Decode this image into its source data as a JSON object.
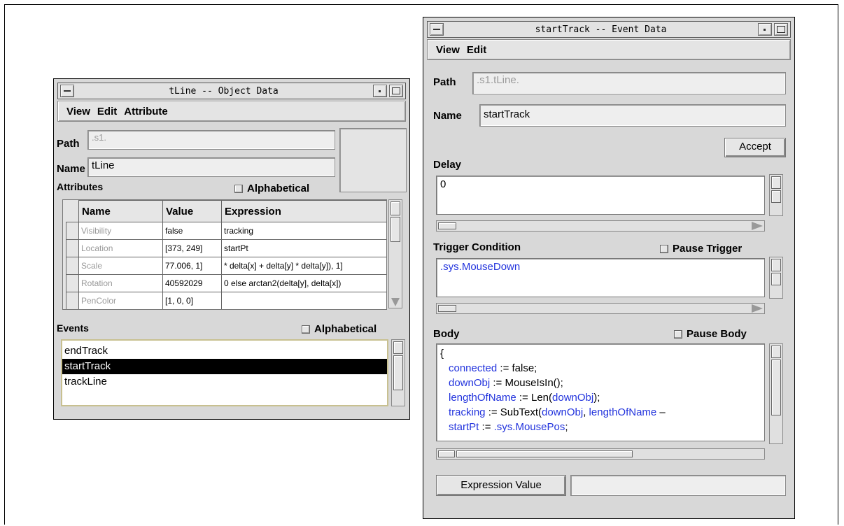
{
  "object_window": {
    "title": "tLine -- Object Data",
    "menu": [
      "View",
      "Edit",
      "Attribute"
    ],
    "path_label": "Path",
    "path_value": ".s1.",
    "name_label": "Name",
    "name_value": "tLine",
    "attributes_label": "Attributes",
    "attributes_alpha": "Alphabetical",
    "table": {
      "headers": [
        "Name",
        "Value",
        "Expression"
      ],
      "rows": [
        {
          "name": "Visibility",
          "value": "false",
          "expression": "tracking"
        },
        {
          "name": "Location",
          "value": "[373, 249]",
          "expression": "startPt"
        },
        {
          "name": "Scale",
          "value": "77.006, 1]",
          "expression": "* delta[x] + delta[y] * delta[y]), 1]"
        },
        {
          "name": "Rotation",
          "value": "40592029",
          "expression": "0 else arctan2(delta[y], delta[x])"
        },
        {
          "name": "PenColor",
          "value": "[1, 0, 0]",
          "expression": ""
        }
      ]
    },
    "events_label": "Events",
    "events_alpha": "Alphabetical",
    "events": [
      "endTrack",
      "startTrack",
      "trackLine"
    ],
    "selected_event": "startTrack"
  },
  "event_window": {
    "title": "startTrack -- Event Data",
    "menu": [
      "View",
      "Edit"
    ],
    "path_label": "Path",
    "path_value": ".s1.tLine.",
    "name_label": "Name",
    "name_value": "startTrack",
    "accept_label": "Accept",
    "delay_label": "Delay",
    "delay_value": "0",
    "trigger_label": "Trigger Condition",
    "pause_trigger_label": "Pause Trigger",
    "trigger_value": ".sys.MouseDown",
    "body_label": "Body",
    "pause_body_label": "Pause Body",
    "body_open": "{",
    "body_lines": [
      {
        "var": "connected",
        "rest": " := false;"
      },
      {
        "var": "downObj",
        "rest": " := MouseIsIn();"
      },
      {
        "var": "lengthOfName",
        "rest": " := Len(",
        "var2": "downObj",
        "rest2": ");"
      },
      {
        "var": "tracking",
        "rest": " := SubText(",
        "var2": "downObj",
        "rest2": ", ",
        "var3": "lengthOfName",
        "rest3": " –"
      },
      {
        "var": "startPt",
        "rest": " := ",
        "var2": ".sys.MousePos",
        "rest2": ";"
      }
    ],
    "expression_value_label": "Expression Value",
    "expression_value": ""
  },
  "colors": {
    "variable": "#2233dd",
    "window_bg": "#d8d8d8",
    "selection": "#000000"
  }
}
